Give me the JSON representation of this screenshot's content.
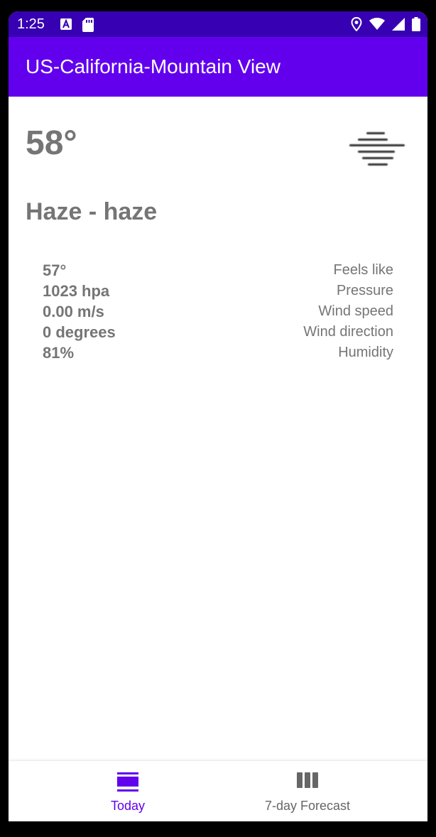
{
  "status_bar": {
    "time": "1:25",
    "icons_left": [
      "a-icon",
      "sd-card-icon"
    ],
    "icons_right": [
      "location-icon",
      "wifi-icon",
      "signal-icon",
      "battery-icon"
    ]
  },
  "app_bar": {
    "title": "US-California-Mountain View"
  },
  "weather": {
    "temperature": "58°",
    "icon": "haze-icon",
    "condition": "Haze - haze",
    "details": [
      {
        "value": "57°",
        "label": "Feels like"
      },
      {
        "value": "1023 hpa",
        "label": "Pressure"
      },
      {
        "value": "0.00 m/s",
        "label": "Wind speed"
      },
      {
        "value": "0 degrees",
        "label": "Wind direction"
      },
      {
        "value": "81%",
        "label": "Humidity"
      }
    ]
  },
  "bottom_nav": {
    "items": [
      {
        "label": "Today",
        "icon": "view-day-icon",
        "selected": true
      },
      {
        "label": "7-day Forecast",
        "icon": "view-week-icon",
        "selected": false
      }
    ]
  },
  "colors": {
    "status_bar": "#3700b3",
    "app_bar": "#6200ee",
    "selected_nav": "#6200ee",
    "unselected_nav": "#666666",
    "text_gray": "#757575"
  }
}
